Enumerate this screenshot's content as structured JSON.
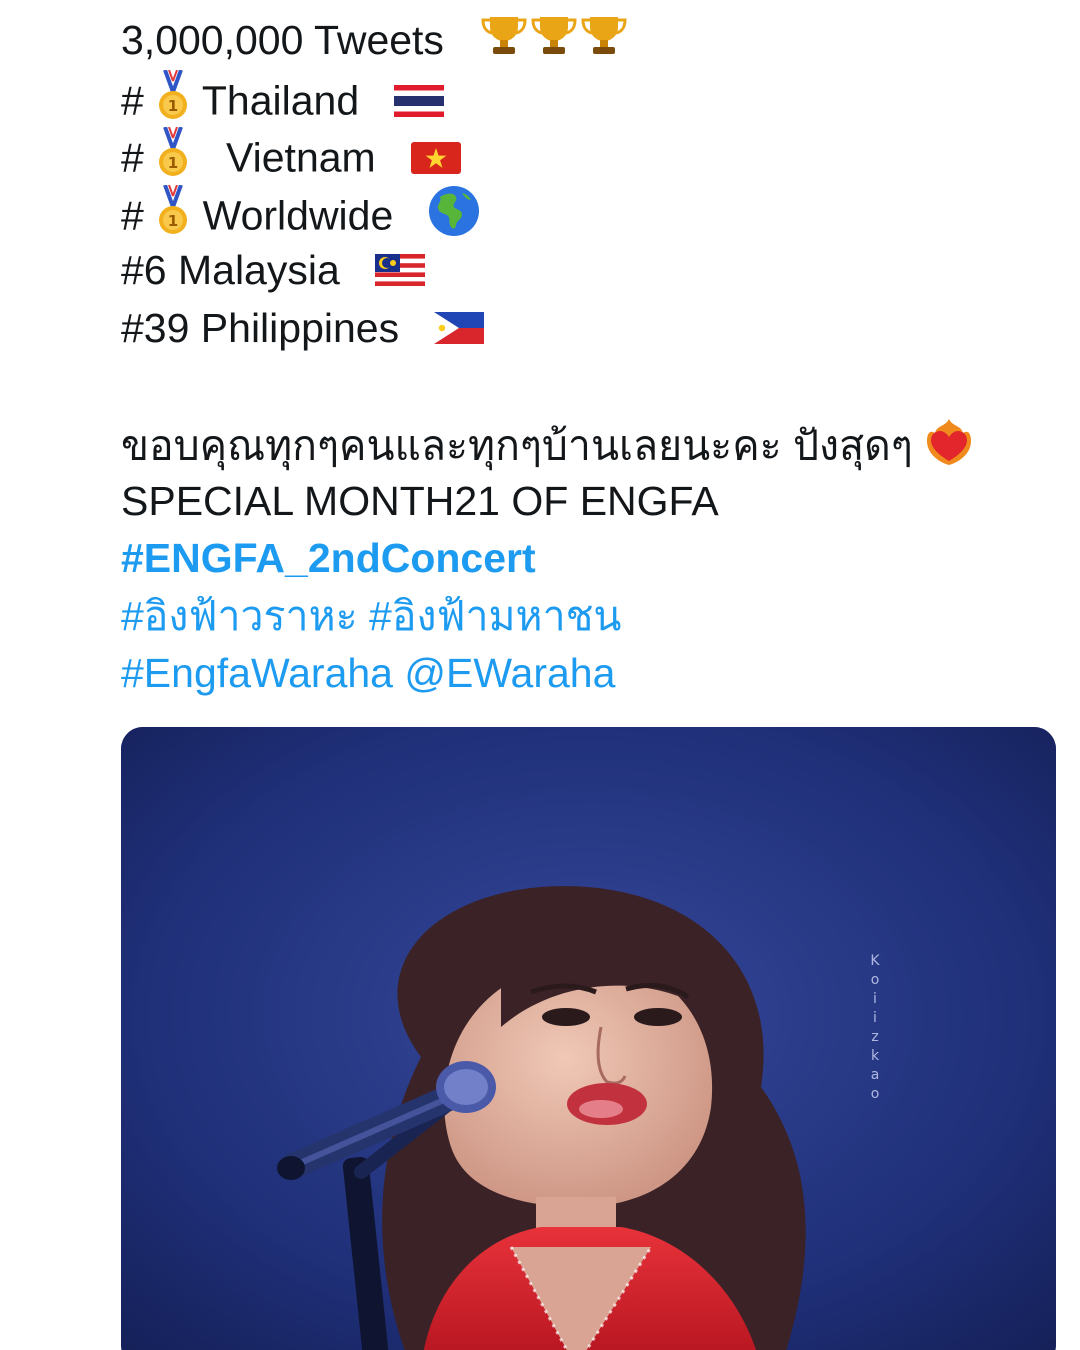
{
  "tweet": {
    "lines": [
      "3,000,000 Tweets",
      "#",
      "Thailand",
      "#",
      "Vietnam",
      "#",
      "Worldwide",
      "#6 Malaysia",
      "#39 Philippines",
      "ขอบคุณทุกๆคนและทุกๆบ้านเลยนะคะ ปังสุดๆ",
      "SPECIAL MONTH21  OF ENGFA"
    ],
    "hashtag_concert": "#ENGFA_2ndConcert",
    "hashtag_thai_1": "#อิงฟ้าวราหะ",
    "hashtag_thai_2": "#อิงฟ้ามหาชน",
    "hashtag_engfa": "#EngfaWaraha",
    "mention": "@EWaraha"
  },
  "media": {
    "watermark": [
      "K",
      "o",
      "i",
      "i",
      "z",
      "k",
      "a",
      "o"
    ]
  },
  "icons": {
    "trophy": "trophy-icon",
    "medal": "gold-medal-icon",
    "globe": "globe-americas-icon",
    "heart": "heart-on-fire-icon",
    "flags": [
      "flag-thailand-icon",
      "flag-vietnam-icon",
      "flag-malaysia-icon",
      "flag-philippines-icon"
    ]
  },
  "colors": {
    "text": "#14171a",
    "link": "#1d9bf0",
    "media_bg": "#1a2a6b",
    "dress": "#d21f2a"
  }
}
